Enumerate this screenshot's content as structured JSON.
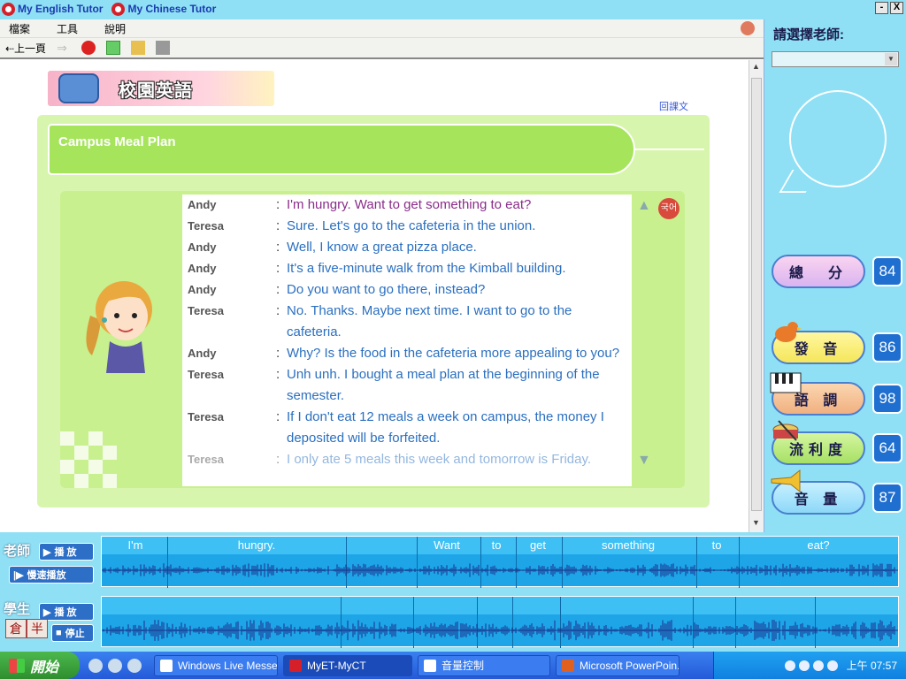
{
  "titlebar": {
    "apps": [
      "My English Tutor",
      "My Chinese Tutor"
    ],
    "minimize": "-",
    "close": "X"
  },
  "menu": {
    "file": "檔案",
    "tools": "工具",
    "help": "說明"
  },
  "toolbar": {
    "back": "⇠上一頁"
  },
  "banner": {
    "text": "校園英語"
  },
  "back_link": "回課文",
  "lesson": {
    "title": "Campus Meal Plan",
    "korean_button": "국어",
    "dialogue": [
      {
        "speaker": "Andy",
        "text": "I'm hungry. Want to get something to eat?"
      },
      {
        "speaker": "Teresa",
        "text": "Sure. Let's go to the cafeteria in the union."
      },
      {
        "speaker": "Andy",
        "text": "Well, I know a great pizza place."
      },
      {
        "speaker": "Andy",
        "text": "It's a five-minute walk from the Kimball building."
      },
      {
        "speaker": "Andy",
        "text": "Do you want to go there, instead?"
      },
      {
        "speaker": "Teresa",
        "text": "No. Thanks. Maybe next time. I want to go to the cafeteria."
      },
      {
        "speaker": "Andy",
        "text": "Why? Is the food in the cafeteria more appealing to you?"
      },
      {
        "speaker": "Teresa",
        "text": "Unh unh. I bought a meal plan at the beginning of the semester."
      },
      {
        "speaker": "Teresa",
        "text": "If I don't eat 12 meals a week on campus, the money I deposited will be forfeited."
      },
      {
        "speaker": "Teresa",
        "text": "I only ate 5 meals this week and tomorrow is Friday."
      }
    ]
  },
  "side": {
    "teacher_label": "請選擇老師:",
    "scores": [
      {
        "label": "總　分",
        "value": "84"
      },
      {
        "label": "發 音",
        "value": "86"
      },
      {
        "label": "語 調",
        "value": "98"
      },
      {
        "label": "流利度",
        "value": "64"
      },
      {
        "label": "音 量",
        "value": "87"
      }
    ]
  },
  "audio": {
    "teacher_role": "老師",
    "student_role": "學生",
    "play": "播 放",
    "slow_play": "慢速播放",
    "stop": "停止",
    "words": [
      "I'm",
      "hungry.",
      "Want",
      "to",
      "get",
      "something",
      "to",
      "eat?"
    ]
  },
  "ime": [
    "倉",
    "半"
  ],
  "taskbar": {
    "start": "開始",
    "tasks": [
      "Windows Live Messe...",
      "MyET-MyCT",
      "音量控制",
      "Microsoft PowerPoin..."
    ],
    "clock": "上午 07:57"
  }
}
